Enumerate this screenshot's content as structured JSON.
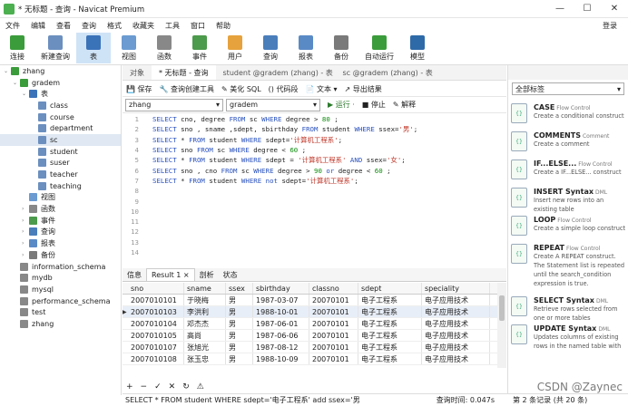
{
  "title": "* 无标题 - 查询 - Navicat Premium",
  "window_controls": [
    "—",
    "☐",
    "✕"
  ],
  "menu": [
    "文件",
    "编辑",
    "查看",
    "查询",
    "格式",
    "收藏夹",
    "工具",
    "窗口",
    "帮助"
  ],
  "login": "登录",
  "toolbar": [
    {
      "label": "连接",
      "icon": "connection-icon",
      "color": "#3b9c3b"
    },
    {
      "label": "新建查询",
      "icon": "new-query-icon",
      "color": "#6b8fbf"
    },
    {
      "label": "表",
      "icon": "table-icon",
      "color": "#3b73b9",
      "active": true
    },
    {
      "label": "视图",
      "icon": "view-icon",
      "color": "#6b9bd1"
    },
    {
      "label": "函数",
      "icon": "function-icon",
      "color": "#888888"
    },
    {
      "label": "事件",
      "icon": "event-icon",
      "color": "#4c9a4c"
    },
    {
      "label": "用户",
      "icon": "user-icon",
      "color": "#e6a23c"
    },
    {
      "label": "查询",
      "icon": "query-icon",
      "color": "#4a7ebb"
    },
    {
      "label": "报表",
      "icon": "report-icon",
      "color": "#5a8ac6"
    },
    {
      "label": "备份",
      "icon": "backup-icon",
      "color": "#7a7a7a"
    },
    {
      "label": "自动运行",
      "icon": "autorun-icon",
      "color": "#3b9c3b"
    },
    {
      "label": "模型",
      "icon": "model-icon",
      "color": "#2e6aa8"
    }
  ],
  "tree": [
    {
      "label": "zhang",
      "level": 0,
      "icon": "connection-icon",
      "color": "#3b9c3b"
    },
    {
      "label": "gradem",
      "level": 1,
      "icon": "database-icon",
      "color": "#3b9c3b"
    },
    {
      "label": "表",
      "level": 2,
      "icon": "table-folder-icon",
      "color": "#3b73b9"
    },
    {
      "label": "class",
      "level": 3,
      "icon": "table-icon",
      "color": "#6b8fbf"
    },
    {
      "label": "course",
      "level": 3,
      "icon": "table-icon",
      "color": "#6b8fbf"
    },
    {
      "label": "department",
      "level": 3,
      "icon": "table-icon",
      "color": "#6b8fbf"
    },
    {
      "label": "sc",
      "level": 3,
      "icon": "table-icon",
      "color": "#6b8fbf",
      "selected": true
    },
    {
      "label": "student",
      "level": 3,
      "icon": "table-icon",
      "color": "#6b8fbf"
    },
    {
      "label": "suser",
      "level": 3,
      "icon": "table-icon",
      "color": "#6b8fbf"
    },
    {
      "label": "teacher",
      "level": 3,
      "icon": "table-icon",
      "color": "#6b8fbf"
    },
    {
      "label": "teaching",
      "level": 3,
      "icon": "table-icon",
      "color": "#6b8fbf"
    },
    {
      "label": "视图",
      "level": 2,
      "icon": "view-icon",
      "color": "#6b9bd1"
    },
    {
      "label": "函数",
      "level": 2,
      "icon": "function-icon",
      "color": "#888888"
    },
    {
      "label": "事件",
      "level": 2,
      "icon": "event-icon",
      "color": "#4c9a4c"
    },
    {
      "label": "查询",
      "level": 2,
      "icon": "query-icon",
      "color": "#4a7ebb"
    },
    {
      "label": "报表",
      "level": 2,
      "icon": "report-icon",
      "color": "#5a8ac6"
    },
    {
      "label": "备份",
      "level": 2,
      "icon": "backup-icon",
      "color": "#7a7a7a"
    },
    {
      "label": "information_schema",
      "level": 1,
      "icon": "database-icon",
      "color": "#888888"
    },
    {
      "label": "mydb",
      "level": 1,
      "icon": "database-icon",
      "color": "#888888"
    },
    {
      "label": "mysql",
      "level": 1,
      "icon": "database-icon",
      "color": "#888888"
    },
    {
      "label": "performance_schema",
      "level": 1,
      "icon": "database-icon",
      "color": "#888888"
    },
    {
      "label": "test",
      "level": 1,
      "icon": "database-icon",
      "color": "#888888"
    },
    {
      "label": "zhang",
      "level": 1,
      "icon": "database-icon",
      "color": "#888888"
    }
  ],
  "tabs": [
    "对象",
    "* 无标题 - 查询",
    "student @gradem (zhang) - 表",
    "sc @gradem (zhang) - 表"
  ],
  "query_toolbar": [
    "💾 保存",
    "🔧 查询创建工具",
    "✎ 美化 SQL",
    "() 代码段",
    "📄 文本 ▾",
    "↗ 导出结果"
  ],
  "connection": "zhang",
  "database": "gradem",
  "run_actions": [
    "▶ 运行 ·",
    "■ 停止",
    "✎ 解释"
  ],
  "sql_lines": [
    [
      {
        "t": "SELECT ",
        "c": "kw"
      },
      {
        "t": "cno, degree ",
        "c": ""
      },
      {
        "t": "FROM ",
        "c": "kw"
      },
      {
        "t": "sc ",
        "c": ""
      },
      {
        "t": "WHERE ",
        "c": "kw"
      },
      {
        "t": "degree > ",
        "c": ""
      },
      {
        "t": "80",
        "c": "num"
      },
      {
        "t": " ;",
        "c": ""
      }
    ],
    [
      {
        "t": "SELECT ",
        "c": "kw"
      },
      {
        "t": "sno , sname ,sdept, sbirthday ",
        "c": ""
      },
      {
        "t": "FROM ",
        "c": "kw"
      },
      {
        "t": "student ",
        "c": ""
      },
      {
        "t": "WHERE ",
        "c": "kw"
      },
      {
        "t": "ssex=",
        "c": ""
      },
      {
        "t": "'男'",
        "c": "str"
      },
      {
        "t": ";",
        "c": ""
      }
    ],
    [
      {
        "t": "SELECT ",
        "c": "kw"
      },
      {
        "t": "* ",
        "c": ""
      },
      {
        "t": "FROM ",
        "c": "kw"
      },
      {
        "t": "student ",
        "c": ""
      },
      {
        "t": "WHERE ",
        "c": "kw"
      },
      {
        "t": "sdept=",
        "c": ""
      },
      {
        "t": "'计算机工程系'",
        "c": "str"
      },
      {
        "t": ";",
        "c": ""
      }
    ],
    [
      {
        "t": "SELECT ",
        "c": "kw"
      },
      {
        "t": "sno ",
        "c": ""
      },
      {
        "t": "FROM ",
        "c": "kw"
      },
      {
        "t": "sc ",
        "c": ""
      },
      {
        "t": "WHERE ",
        "c": "kw"
      },
      {
        "t": "degree < ",
        "c": ""
      },
      {
        "t": "60",
        "c": "num"
      },
      {
        "t": " ;",
        "c": ""
      }
    ],
    [
      {
        "t": "SELECT ",
        "c": "kw"
      },
      {
        "t": "* ",
        "c": ""
      },
      {
        "t": "FROM ",
        "c": "kw"
      },
      {
        "t": "student ",
        "c": ""
      },
      {
        "t": "WHERE ",
        "c": "kw"
      },
      {
        "t": "sdept = ",
        "c": ""
      },
      {
        "t": "'计算机工程系'",
        "c": "str"
      },
      {
        "t": " AND ",
        "c": "kw"
      },
      {
        "t": "ssex=",
        "c": ""
      },
      {
        "t": "'女'",
        "c": "str"
      },
      {
        "t": ";",
        "c": ""
      }
    ],
    [
      {
        "t": "SELECT ",
        "c": "kw"
      },
      {
        "t": "sno , cno ",
        "c": ""
      },
      {
        "t": "FROM ",
        "c": "kw"
      },
      {
        "t": "sc ",
        "c": ""
      },
      {
        "t": "WHERE ",
        "c": "kw"
      },
      {
        "t": "degree > ",
        "c": ""
      },
      {
        "t": "90",
        "c": "num"
      },
      {
        "t": " or ",
        "c": "kw"
      },
      {
        "t": "degree < ",
        "c": ""
      },
      {
        "t": "60",
        "c": "num"
      },
      {
        "t": " ;",
        "c": ""
      }
    ],
    [
      {
        "t": "SELECT ",
        "c": "kw"
      },
      {
        "t": "* ",
        "c": ""
      },
      {
        "t": "FROM ",
        "c": "kw"
      },
      {
        "t": "student ",
        "c": ""
      },
      {
        "t": "WHERE ",
        "c": "kw"
      },
      {
        "t": "not ",
        "c": "kw"
      },
      {
        "t": "sdept=",
        "c": ""
      },
      {
        "t": "'计算机工程系'",
        "c": "str"
      },
      {
        "t": ";",
        "c": ""
      }
    ],
    [],
    [],
    [],
    [],
    [],
    [],
    []
  ],
  "result_tabs": [
    "信息",
    "Result 1 ×",
    "剖析",
    "状态"
  ],
  "columns": [
    "sno",
    "sname",
    "ssex",
    "sbirthday",
    "classno",
    "sdept",
    "speciality"
  ],
  "rows": [
    [
      "2007010101",
      "于晓梅",
      "男",
      "1987-03-07",
      "20070101",
      "电子工程系",
      "电子应用技术"
    ],
    [
      "2007010103",
      "李洪利",
      "男",
      "1988-10-01",
      "20070101",
      "电子工程系",
      "电子应用技术"
    ],
    [
      "2007010104",
      "邓杰杰",
      "男",
      "1987-06-01",
      "20070101",
      "电子工程系",
      "电子应用技术"
    ],
    [
      "2007010105",
      "高尚",
      "男",
      "1987-06-06",
      "20070101",
      "电子工程系",
      "电子应用技术"
    ],
    [
      "2007010107",
      "张旭光",
      "男",
      "1987-08-12",
      "20070101",
      "电子工程系",
      "电子应用技术"
    ],
    [
      "2007010108",
      "张玉忠",
      "男",
      "1988-10-09",
      "20070101",
      "电子工程系",
      "电子应用技术"
    ]
  ],
  "grid_footer": [
    "+",
    "−",
    "✓",
    "✕",
    "↻",
    "⚠"
  ],
  "status_sql": "SELECT * FROM student WHERE sdept='电子工程系' add ssex='男",
  "status_time": "查询时间: 0.047s",
  "status_count": "第 2 条记录 (共 20 条)",
  "snippet_filter": "全部标签",
  "snippets": [
    {
      "title": "CASE",
      "tag": "Flow Control",
      "desc": "Create a conditional construct"
    },
    {
      "title": "COMMENTS",
      "tag": "Comment",
      "desc": "Create a comment"
    },
    {
      "title": "IF...ELSE...",
      "tag": "Flow Control",
      "desc": "Create a IF...ELSE... construct"
    },
    {
      "title": "INSERT Syntax",
      "tag": "DML",
      "desc": "Insert new rows into an existing table"
    },
    {
      "title": "LOOP",
      "tag": "Flow Control",
      "desc": "Create a simple loop construct"
    },
    {
      "title": "REPEAT",
      "tag": "Flow Control",
      "desc": "Create A REPEAT construct. The Statement list is repeated until the search_condition expression is true."
    },
    {
      "title": "SELECT Syntax",
      "tag": "DML",
      "desc": "Retrieve rows selected from one or more tables"
    },
    {
      "title": "UPDATE Syntax",
      "tag": "DML",
      "desc": "Updates columns of existing rows in the named table with"
    }
  ],
  "watermark": "CSDN @Zaynec"
}
